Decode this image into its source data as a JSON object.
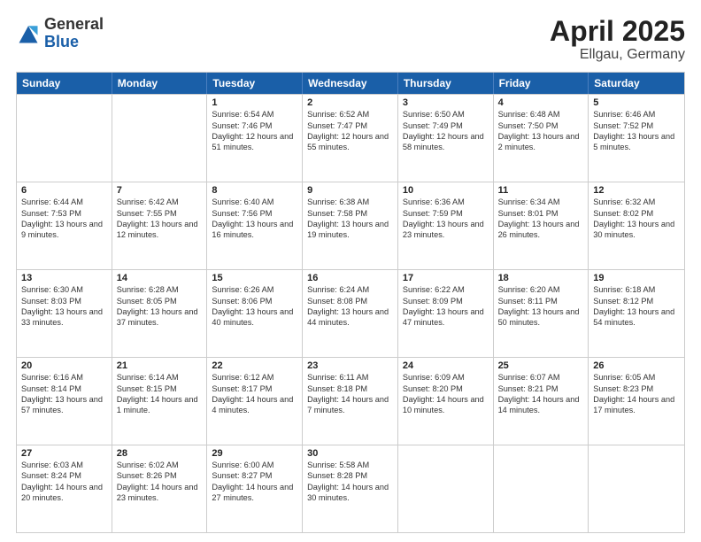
{
  "logo": {
    "general": "General",
    "blue": "Blue"
  },
  "title": "April 2025",
  "subtitle": "Ellgau, Germany",
  "days": [
    "Sunday",
    "Monday",
    "Tuesday",
    "Wednesday",
    "Thursday",
    "Friday",
    "Saturday"
  ],
  "rows": [
    [
      {
        "day": "",
        "info": ""
      },
      {
        "day": "",
        "info": ""
      },
      {
        "day": "1",
        "info": "Sunrise: 6:54 AM\nSunset: 7:46 PM\nDaylight: 12 hours and 51 minutes."
      },
      {
        "day": "2",
        "info": "Sunrise: 6:52 AM\nSunset: 7:47 PM\nDaylight: 12 hours and 55 minutes."
      },
      {
        "day": "3",
        "info": "Sunrise: 6:50 AM\nSunset: 7:49 PM\nDaylight: 12 hours and 58 minutes."
      },
      {
        "day": "4",
        "info": "Sunrise: 6:48 AM\nSunset: 7:50 PM\nDaylight: 13 hours and 2 minutes."
      },
      {
        "day": "5",
        "info": "Sunrise: 6:46 AM\nSunset: 7:52 PM\nDaylight: 13 hours and 5 minutes."
      }
    ],
    [
      {
        "day": "6",
        "info": "Sunrise: 6:44 AM\nSunset: 7:53 PM\nDaylight: 13 hours and 9 minutes."
      },
      {
        "day": "7",
        "info": "Sunrise: 6:42 AM\nSunset: 7:55 PM\nDaylight: 13 hours and 12 minutes."
      },
      {
        "day": "8",
        "info": "Sunrise: 6:40 AM\nSunset: 7:56 PM\nDaylight: 13 hours and 16 minutes."
      },
      {
        "day": "9",
        "info": "Sunrise: 6:38 AM\nSunset: 7:58 PM\nDaylight: 13 hours and 19 minutes."
      },
      {
        "day": "10",
        "info": "Sunrise: 6:36 AM\nSunset: 7:59 PM\nDaylight: 13 hours and 23 minutes."
      },
      {
        "day": "11",
        "info": "Sunrise: 6:34 AM\nSunset: 8:01 PM\nDaylight: 13 hours and 26 minutes."
      },
      {
        "day": "12",
        "info": "Sunrise: 6:32 AM\nSunset: 8:02 PM\nDaylight: 13 hours and 30 minutes."
      }
    ],
    [
      {
        "day": "13",
        "info": "Sunrise: 6:30 AM\nSunset: 8:03 PM\nDaylight: 13 hours and 33 minutes."
      },
      {
        "day": "14",
        "info": "Sunrise: 6:28 AM\nSunset: 8:05 PM\nDaylight: 13 hours and 37 minutes."
      },
      {
        "day": "15",
        "info": "Sunrise: 6:26 AM\nSunset: 8:06 PM\nDaylight: 13 hours and 40 minutes."
      },
      {
        "day": "16",
        "info": "Sunrise: 6:24 AM\nSunset: 8:08 PM\nDaylight: 13 hours and 44 minutes."
      },
      {
        "day": "17",
        "info": "Sunrise: 6:22 AM\nSunset: 8:09 PM\nDaylight: 13 hours and 47 minutes."
      },
      {
        "day": "18",
        "info": "Sunrise: 6:20 AM\nSunset: 8:11 PM\nDaylight: 13 hours and 50 minutes."
      },
      {
        "day": "19",
        "info": "Sunrise: 6:18 AM\nSunset: 8:12 PM\nDaylight: 13 hours and 54 minutes."
      }
    ],
    [
      {
        "day": "20",
        "info": "Sunrise: 6:16 AM\nSunset: 8:14 PM\nDaylight: 13 hours and 57 minutes."
      },
      {
        "day": "21",
        "info": "Sunrise: 6:14 AM\nSunset: 8:15 PM\nDaylight: 14 hours and 1 minute."
      },
      {
        "day": "22",
        "info": "Sunrise: 6:12 AM\nSunset: 8:17 PM\nDaylight: 14 hours and 4 minutes."
      },
      {
        "day": "23",
        "info": "Sunrise: 6:11 AM\nSunset: 8:18 PM\nDaylight: 14 hours and 7 minutes."
      },
      {
        "day": "24",
        "info": "Sunrise: 6:09 AM\nSunset: 8:20 PM\nDaylight: 14 hours and 10 minutes."
      },
      {
        "day": "25",
        "info": "Sunrise: 6:07 AM\nSunset: 8:21 PM\nDaylight: 14 hours and 14 minutes."
      },
      {
        "day": "26",
        "info": "Sunrise: 6:05 AM\nSunset: 8:23 PM\nDaylight: 14 hours and 17 minutes."
      }
    ],
    [
      {
        "day": "27",
        "info": "Sunrise: 6:03 AM\nSunset: 8:24 PM\nDaylight: 14 hours and 20 minutes."
      },
      {
        "day": "28",
        "info": "Sunrise: 6:02 AM\nSunset: 8:26 PM\nDaylight: 14 hours and 23 minutes."
      },
      {
        "day": "29",
        "info": "Sunrise: 6:00 AM\nSunset: 8:27 PM\nDaylight: 14 hours and 27 minutes."
      },
      {
        "day": "30",
        "info": "Sunrise: 5:58 AM\nSunset: 8:28 PM\nDaylight: 14 hours and 30 minutes."
      },
      {
        "day": "",
        "info": ""
      },
      {
        "day": "",
        "info": ""
      },
      {
        "day": "",
        "info": ""
      }
    ]
  ]
}
